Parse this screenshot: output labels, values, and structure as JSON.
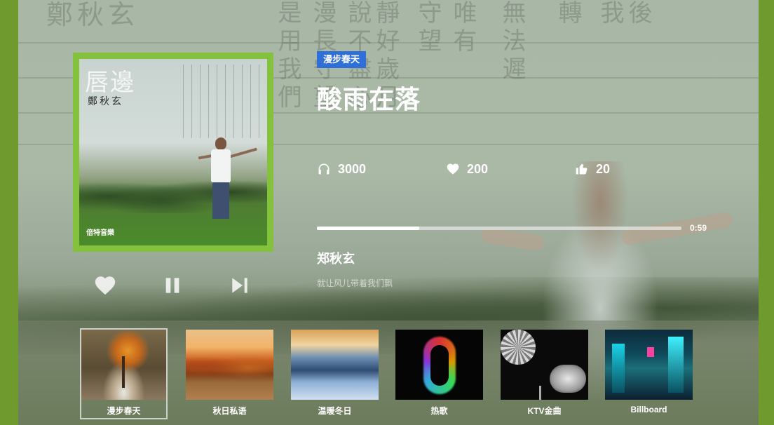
{
  "player": {
    "category_tag": "漫步春天",
    "song_title": "酸雨在落",
    "stats": {
      "listens": "3000",
      "likes": "200",
      "thumbs_up": "20"
    },
    "progress": {
      "fraction": 0.28,
      "remaining_time": "0:59"
    },
    "artist": "郑秋玄",
    "lyric_line": "就让风儿带着我们飘"
  },
  "album_cover": {
    "title": "唇邊",
    "artist_signature": "鄭秋玄",
    "label": "倍特音樂"
  },
  "controls": {
    "like_icon": "heart-icon",
    "pause_icon": "pause-icon",
    "next_icon": "next-track-icon"
  },
  "playlists": [
    {
      "label": "漫步春天",
      "selected": true,
      "thumb": "autumn-tree"
    },
    {
      "label": "秋日私语",
      "selected": false,
      "thumb": "autumn-lake"
    },
    {
      "label": "温暖冬日",
      "selected": false,
      "thumb": "frozen-lake"
    },
    {
      "label": "热歌",
      "selected": false,
      "thumb": "music-note"
    },
    {
      "label": "KTV金曲",
      "selected": false,
      "thumb": "disco-ball"
    },
    {
      "label": "Billboard",
      "selected": false,
      "thumb": "neon-city"
    }
  ],
  "colors": {
    "accent": "#2f6fd8",
    "frame_green": "#84c13d",
    "side_green": "#6f9b2e"
  }
}
